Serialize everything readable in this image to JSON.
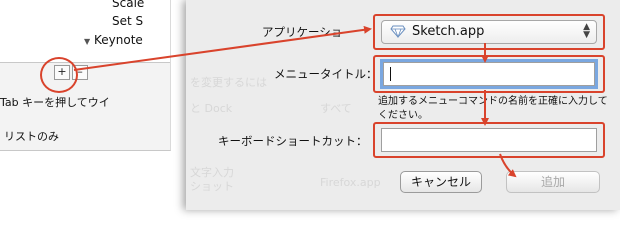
{
  "left_pane": {
    "list_items": [
      "Scale",
      "Set S",
      "Keynote"
    ],
    "add_button": "+",
    "remove_button": "–",
    "hint_line1": "Tab キーを押してウイ",
    "hint_line2": "リストのみ"
  },
  "dialog": {
    "labels": {
      "application": "アプリケーショ",
      "menu_title": "メニュータイトル：",
      "shortcut": "キーボードショートカット："
    },
    "application_value": "Sketch.app",
    "menu_title_value": "",
    "shortcut_value": "",
    "description": "追加するメニューコマンドの名前を正確に入力してください。",
    "cancel_label": "キャンセル",
    "add_label": "追加",
    "ghost_texts": [
      "を変更するには",
      "と Dock",
      "すべて",
      "文字入力",
      "ショット",
      "Firefox.app"
    ]
  },
  "colors": {
    "highlight": "#d9432c",
    "focus_ring": "#7aa7e0",
    "dialog_bg": "#ececec"
  },
  "icons": [
    "sketch-diamond-icon",
    "popup-arrows-icon",
    "disclosure-triangle-icon"
  ]
}
